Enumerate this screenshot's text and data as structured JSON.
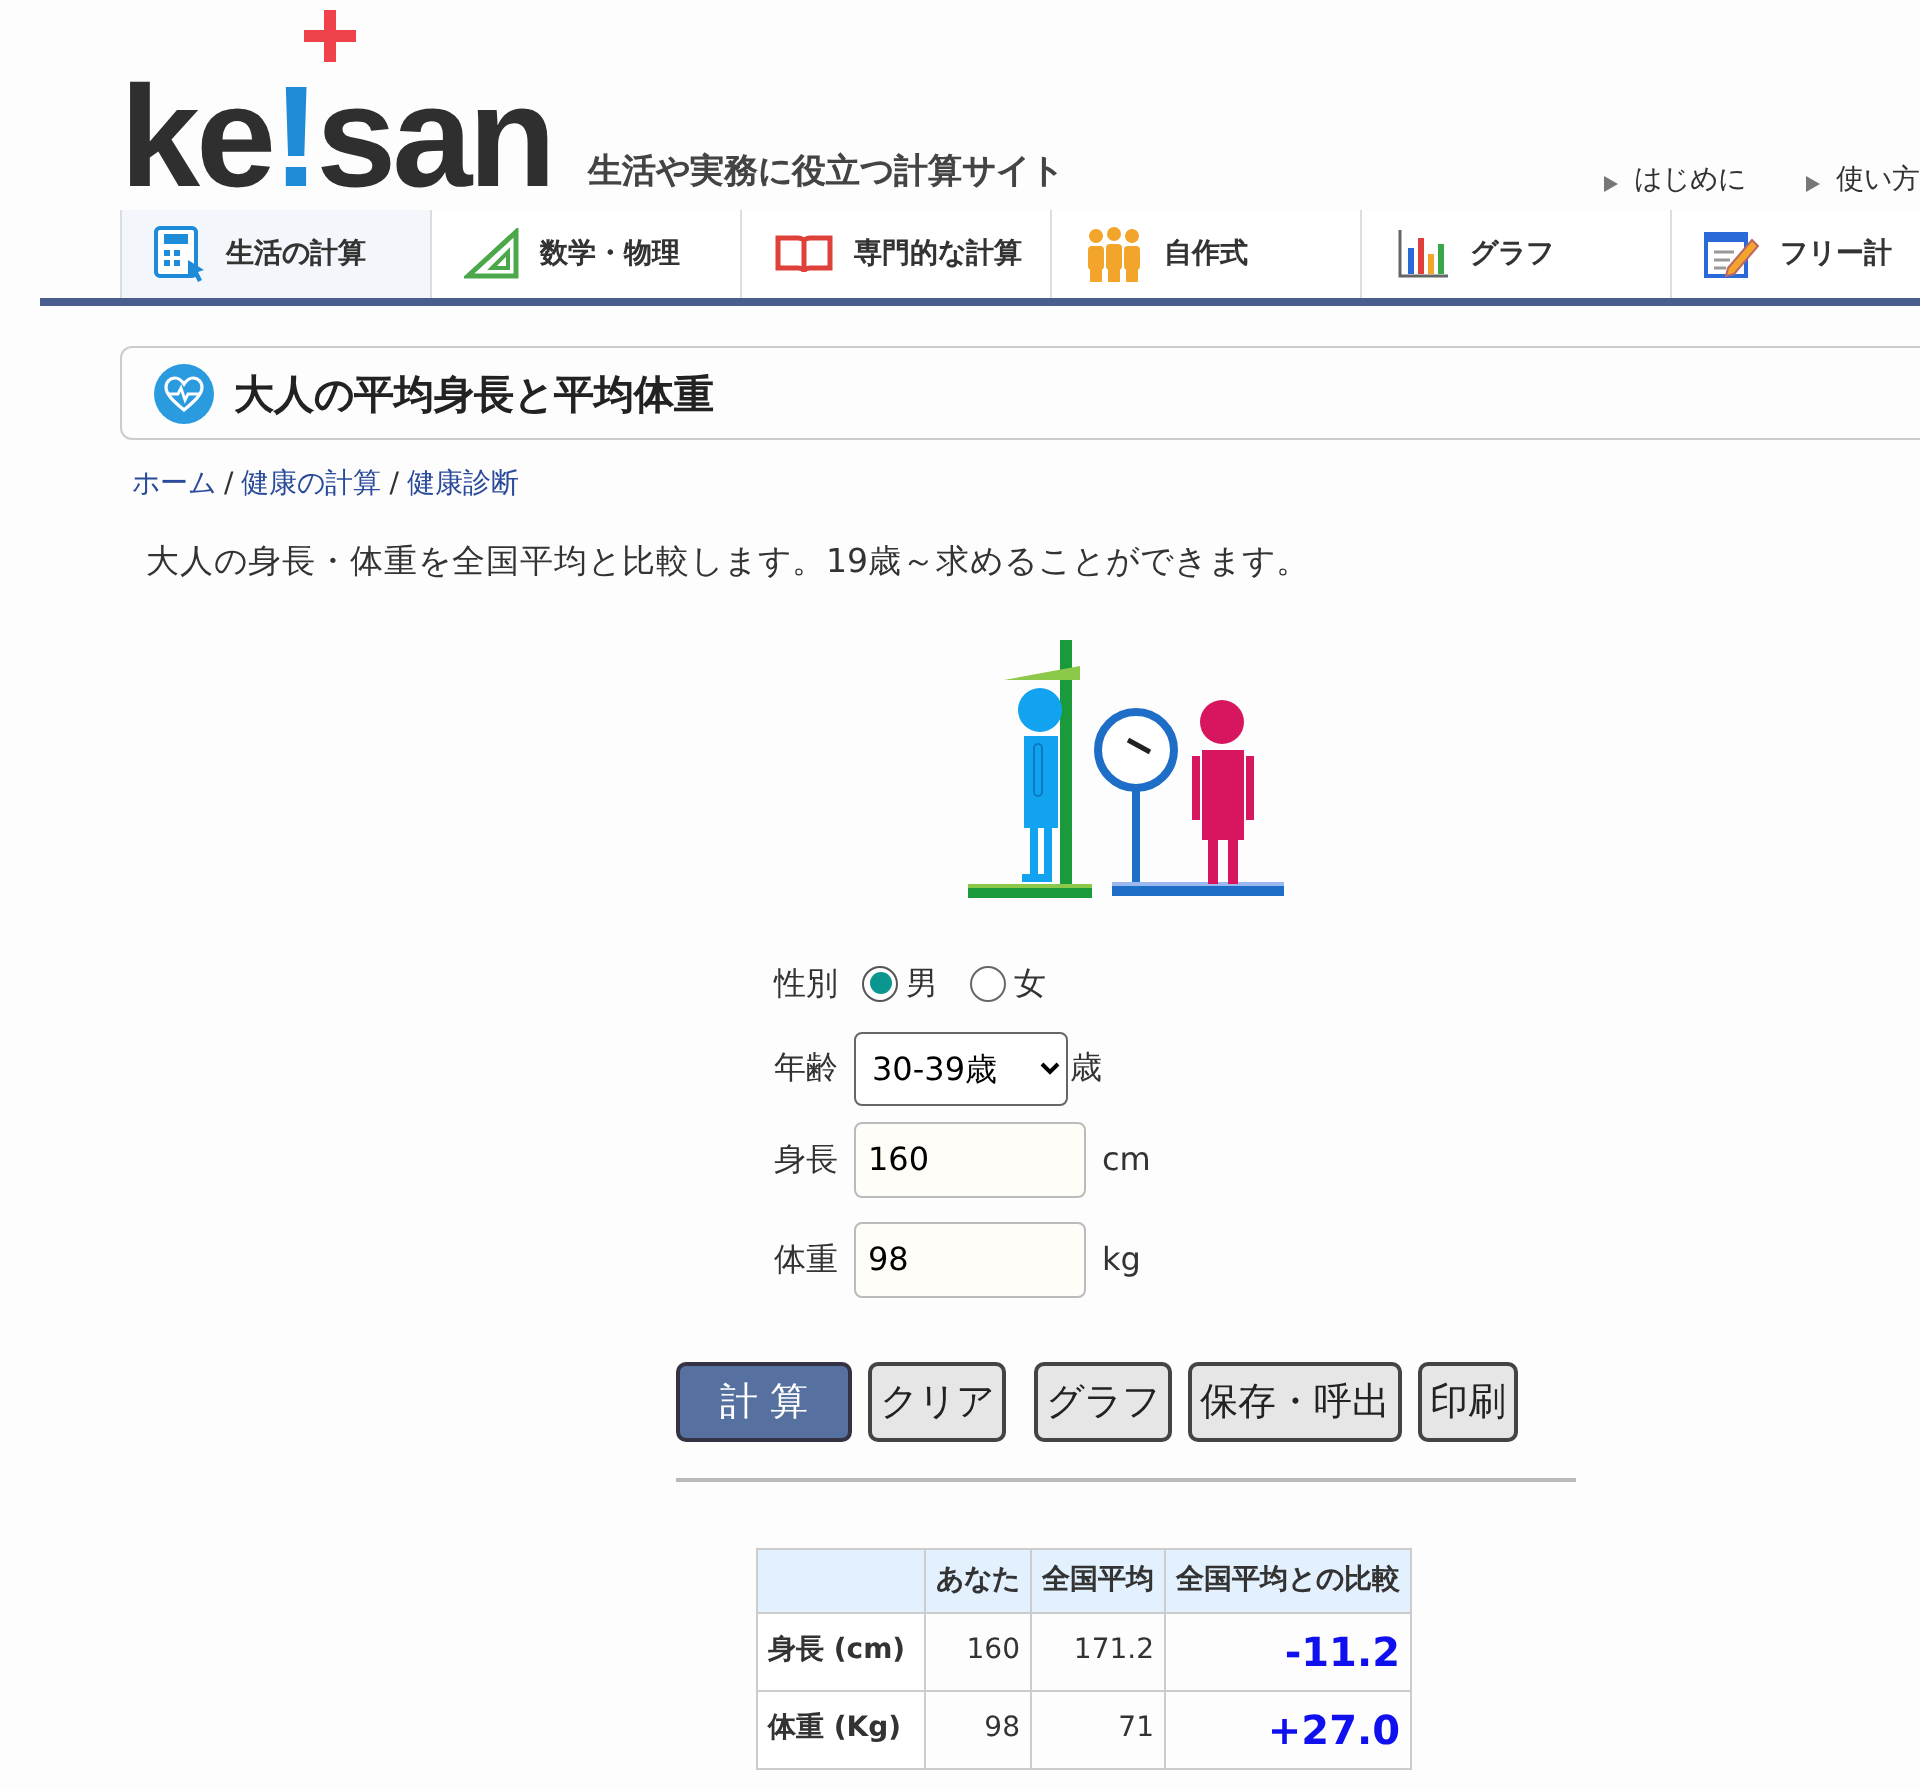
{
  "header": {
    "logo": {
      "before": "ke",
      "mark": "!",
      "after": "san"
    },
    "tagline": "生活や実務に役立つ計算サイト",
    "links": [
      "はじめに",
      "使い方"
    ]
  },
  "nav": [
    {
      "label": "生活の計算",
      "selected": true
    },
    {
      "label": "数学・物理",
      "selected": false
    },
    {
      "label": "専門的な計算",
      "selected": false
    },
    {
      "label": "自作式",
      "selected": false
    },
    {
      "label": "グラフ",
      "selected": false
    },
    {
      "label": "フリー計",
      "selected": false
    }
  ],
  "page_title": "大人の平均身長と平均体重",
  "breadcrumb": [
    {
      "kind": "link",
      "text": "ホーム"
    },
    {
      "kind": "separator",
      "text": "/"
    },
    {
      "kind": "link",
      "text": "健康の計算"
    },
    {
      "kind": "separator",
      "text": "/"
    },
    {
      "kind": "link",
      "text": "健康診断"
    }
  ],
  "description": "大人の身長・体重を全国平均と比較します。19歳～求めることができます。",
  "form": {
    "sex": {
      "label": "性別",
      "options": [
        {
          "label": "男",
          "selected": true
        },
        {
          "label": "女",
          "selected": false
        }
      ]
    },
    "age": {
      "label": "年齢",
      "value": "30-39歳",
      "unit": "歳"
    },
    "height": {
      "label": "身長",
      "value": "160",
      "unit": "cm"
    },
    "weight": {
      "label": "体重",
      "value": "98",
      "unit": "kg"
    }
  },
  "buttons": [
    {
      "label": "計 算",
      "kind": "primary"
    },
    {
      "label": "クリア",
      "kind": "plain"
    },
    {
      "label": "グラフ",
      "kind": "plain"
    },
    {
      "label": "保存・呼出",
      "kind": "plain"
    },
    {
      "label": "印刷",
      "kind": "plain"
    }
  ],
  "table": {
    "columns": [
      "あなた",
      "全国平均",
      "全国平均との比較"
    ],
    "rows": [
      {
        "label": "身長 (cm)",
        "cells": [
          "160",
          "171.2",
          "-11.2"
        ]
      },
      {
        "label": "体重 (Kg)",
        "cells": [
          "98",
          "71",
          "+27.0"
        ]
      }
    ]
  }
}
